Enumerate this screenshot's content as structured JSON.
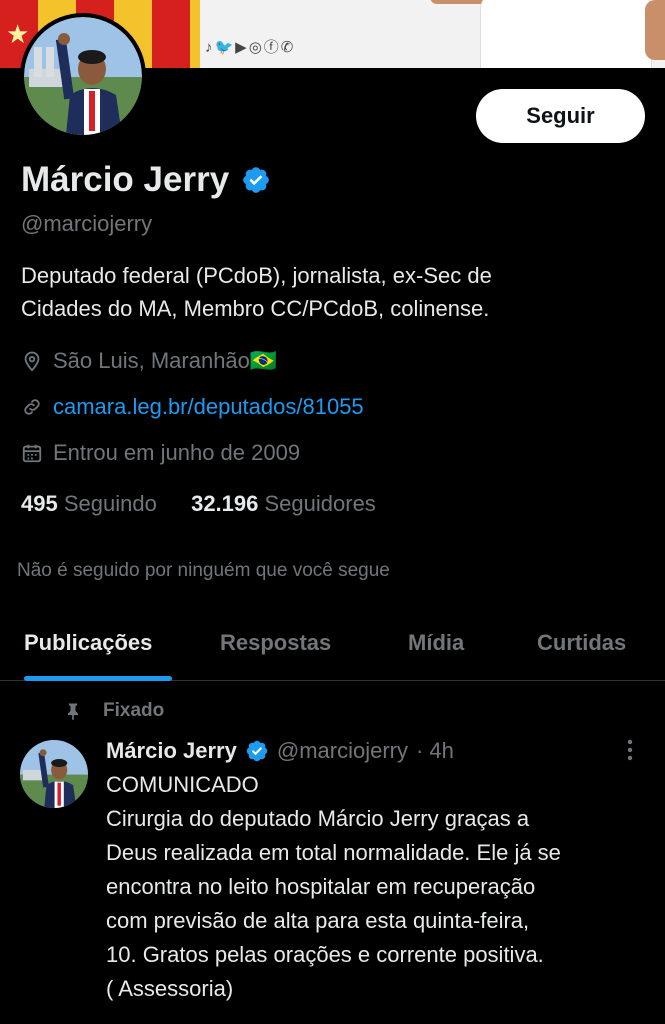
{
  "banner": {
    "social_icons": [
      "tiktok-icon",
      "twitter-icon",
      "youtube-icon",
      "instagram-icon",
      "facebook-icon",
      "whatsapp-icon"
    ],
    "social_glyphs": "♪🐦▶◎ⓕ✆"
  },
  "profile": {
    "follow_label": "Seguir",
    "name": "Márcio Jerry",
    "handle": "@marciojerry",
    "bio_lines": [
      "Deputado federal  (PCdoB), jornalista, ex-Sec de",
      "Cidades do MA, Membro CC/PCdoB, colinense."
    ],
    "location": "São Luis, Maranhão🇧🇷",
    "website": "camara.leg.br/deputados/81055",
    "joined": "Entrou em junho de 2009",
    "following_count": "495",
    "following_label": "Seguindo",
    "followers_count": "32.196",
    "followers_label": "Seguidores",
    "not_followed": "Não é seguido por ninguém que você segue"
  },
  "tabs": [
    {
      "label": "Publicações",
      "active": true
    },
    {
      "label": "Respostas",
      "active": false
    },
    {
      "label": "Mídia",
      "active": false
    },
    {
      "label": "Curtidas",
      "active": false
    }
  ],
  "post": {
    "pinned_label": "Fixado",
    "author_name": "Márcio Jerry",
    "author_handle": "@marciojerry",
    "time": "· 4h",
    "lines": [
      "COMUNICADO",
      "Cirurgia do deputado Márcio Jerry graças a",
      "Deus realizada em total normalidade. Ele já se",
      "encontra no leito hospitalar em recuperação",
      "com previsão de alta para esta quinta-feira,",
      "10. Gratos pelas orações e corrente positiva.",
      "( Assessoria)"
    ]
  },
  "colors": {
    "background": "#000000",
    "accent": "#1d9bf0",
    "muted": "#71767b",
    "text": "#e7e9ea"
  }
}
